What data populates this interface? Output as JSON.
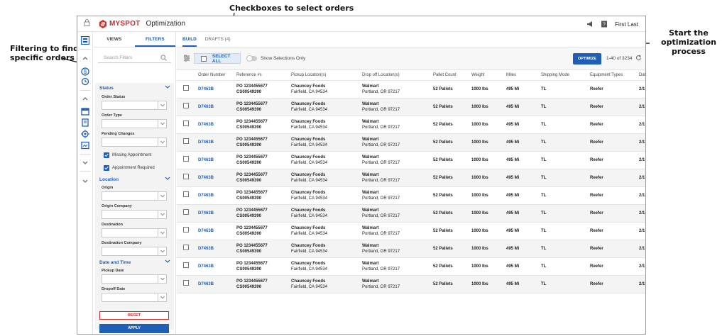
{
  "annotations": {
    "top": "Checkboxes to select orders",
    "left": [
      "Filtering to find",
      "specific orders"
    ],
    "right": [
      "Start the",
      "optimization process"
    ]
  },
  "header": {
    "brand": "MYSPOT",
    "product": "Optimization",
    "user": "First Last",
    "brand_color": "#c9302c"
  },
  "filter_panel": {
    "tabs": [
      "VIEWS",
      "FILTERS"
    ],
    "active_tab": "FILTERS",
    "search_placeholder": "Search Filters",
    "status_title": "Status",
    "order_status_label": "Order Status",
    "order_type_label": "Order Type",
    "pending_changes_label": "Pending Changes",
    "check_missing_appointment": "Missing Appointment",
    "check_appointment_required": "Appointment Required",
    "location_title": "Location",
    "origin_label": "Origin",
    "origin_company_label": "Origin Company",
    "destination_label": "Destination",
    "destination_company_label": "Destination Company",
    "datetime_title": "Date and Time",
    "pickup_date_label": "Pickup Date",
    "dropoff_date_label": "Dropoff Date",
    "reset": "RESET",
    "apply": "APPLY"
  },
  "main": {
    "tabs": [
      "BUILD",
      "DRAFTS (4)"
    ],
    "active_tab": "BUILD",
    "select_all": "SELECT ALL",
    "show_selections": "Show Selections Only",
    "optimize": "OPTIMIZE",
    "range": "1-40 of 3234",
    "accent": "#1f5fb5"
  },
  "table": {
    "columns": [
      "",
      "Order Number",
      "Reference #s",
      "Pickup Location(s)",
      "Drop off Location(s)",
      "Pallet Count",
      "Weight",
      "Miles",
      "Shipping Mode",
      "Equipment Types",
      "Date"
    ],
    "rows": [
      {
        "order": "D7463B",
        "ref1": "PO 1234455677",
        "ref2": "CS00549390",
        "pickup_name": "Chauncey Foods",
        "pickup_addr": "Fairfield, CA 94534",
        "drop_name": "Walmart",
        "drop_addr": "Portland, OR 97217",
        "pallets": "52 Pallets",
        "weight": "1000 lbs",
        "miles": "495 Mi",
        "mode": "TL",
        "equipment": "Reefer",
        "date": "2/1"
      },
      {
        "order": "D7463B",
        "ref1": "PO 1234455677",
        "ref2": "CS00549390",
        "pickup_name": "Chauncey Foods",
        "pickup_addr": "Fairfield, CA 94534",
        "drop_name": "Walmart",
        "drop_addr": "Portland, OR 97217",
        "pallets": "52 Pallets",
        "weight": "1000 lbs",
        "miles": "495 Mi",
        "mode": "TL",
        "equipment": "Reefer",
        "date": "2/1"
      },
      {
        "order": "D7463B",
        "ref1": "PO 1234455677",
        "ref2": "CS00549390",
        "pickup_name": "Chauncey Foods",
        "pickup_addr": "Fairfield, CA 94534",
        "drop_name": "Walmart",
        "drop_addr": "Portland, OR 97217",
        "pallets": "52 Pallets",
        "weight": "1000 lbs",
        "miles": "495 Mi",
        "mode": "TL",
        "equipment": "Reefer",
        "date": "2/1"
      },
      {
        "order": "D7463B",
        "ref1": "PO 1234455677",
        "ref2": "CS00549390",
        "pickup_name": "Chauncey Foods",
        "pickup_addr": "Fairfield, CA 94534",
        "drop_name": "Walmart",
        "drop_addr": "Portland, OR 97217",
        "pallets": "52 Pallets",
        "weight": "1000 lbs",
        "miles": "495 Mi",
        "mode": "TL",
        "equipment": "Reefer",
        "date": "2/1"
      },
      {
        "order": "D7463B",
        "ref1": "PO 1234455677",
        "ref2": "CS00549390",
        "pickup_name": "Chauncey Foods",
        "pickup_addr": "Fairfield, CA 94534",
        "drop_name": "Walmart",
        "drop_addr": "Portland, OR 97217",
        "pallets": "52 Pallets",
        "weight": "1000 lbs",
        "miles": "495 Mi",
        "mode": "TL",
        "equipment": "Reefer",
        "date": "2/1"
      },
      {
        "order": "D7463B",
        "ref1": "PO 1234455677",
        "ref2": "CS00549390",
        "pickup_name": "Chauncey Foods",
        "pickup_addr": "Fairfield, CA 94534",
        "drop_name": "Walmart",
        "drop_addr": "Portland, OR 97217",
        "pallets": "52 Pallets",
        "weight": "1000 lbs",
        "miles": "495 Mi",
        "mode": "TL",
        "equipment": "Reefer",
        "date": "2/1"
      },
      {
        "order": "D7463B",
        "ref1": "PO 1234455677",
        "ref2": "CS00549390",
        "pickup_name": "Chauncey Foods",
        "pickup_addr": "Fairfield, CA 94534",
        "drop_name": "Walmart",
        "drop_addr": "Portland, OR 97217",
        "pallets": "52 Pallets",
        "weight": "1000 lbs",
        "miles": "495 Mi",
        "mode": "TL",
        "equipment": "Reefer",
        "date": "2/1"
      },
      {
        "order": "D7463B",
        "ref1": "PO 1234455677",
        "ref2": "CS00549390",
        "pickup_name": "Chauncey Foods",
        "pickup_addr": "Fairfield, CA 94534",
        "drop_name": "Walmart",
        "drop_addr": "Portland, OR 97217",
        "pallets": "52 Pallets",
        "weight": "1000 lbs",
        "miles": "495 Mi",
        "mode": "TL",
        "equipment": "Reefer",
        "date": "2/1"
      },
      {
        "order": "D7463B",
        "ref1": "PO 1234455677",
        "ref2": "CS00549390",
        "pickup_name": "Chauncey Foods",
        "pickup_addr": "Fairfield, CA 94534",
        "drop_name": "Walmart",
        "drop_addr": "Portland, OR 97217",
        "pallets": "52 Pallets",
        "weight": "1000 lbs",
        "miles": "495 Mi",
        "mode": "TL",
        "equipment": "Reefer",
        "date": "2/1"
      },
      {
        "order": "D7463B",
        "ref1": "PO 1234455677",
        "ref2": "CS00549390",
        "pickup_name": "Chauncey Foods",
        "pickup_addr": "Fairfield, CA 94534",
        "drop_name": "Walmart",
        "drop_addr": "Portland, OR 97217",
        "pallets": "52 Pallets",
        "weight": "1000 lbs",
        "miles": "495 Mi",
        "mode": "TL",
        "equipment": "Reefer",
        "date": "2/1"
      },
      {
        "order": "D7463B",
        "ref1": "PO 1234455677",
        "ref2": "CS00549390",
        "pickup_name": "Chauncey Foods",
        "pickup_addr": "Fairfield, CA 94534",
        "drop_name": "Walmart",
        "drop_addr": "Portland, OR 97217",
        "pallets": "52 Pallets",
        "weight": "1000 lbs",
        "miles": "495 Mi",
        "mode": "TL",
        "equipment": "Reefer",
        "date": "2/1"
      },
      {
        "order": "D7463B",
        "ref1": "PO 1234455677",
        "ref2": "CS00549390",
        "pickup_name": "Chauncey Foods",
        "pickup_addr": "Fairfield, CA 94534",
        "drop_name": "Walmart",
        "drop_addr": "Portland, OR 97217",
        "pallets": "52 Pallets",
        "weight": "1000 lbs",
        "miles": "495 Mi",
        "mode": "TL",
        "equipment": "Reefer",
        "date": "2/1"
      }
    ]
  }
}
